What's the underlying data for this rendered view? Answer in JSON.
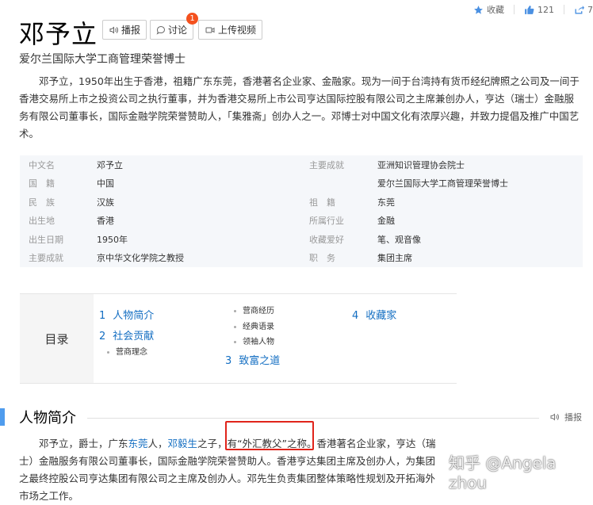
{
  "stats": {
    "collect": "收藏",
    "likes": "121",
    "shares": "7"
  },
  "title": "邓予立",
  "buttons": {
    "broadcast": "播报",
    "discuss": "讨论",
    "discuss_badge": "1",
    "upload": "上传视频"
  },
  "subtitle": "爱尔兰国际大学工商管理荣誉博士",
  "intro": {
    "p1": "邓予立，1950年出生于香港，祖籍广东东莞，香港著名企业家、金融家。现为一间于台湾持有货币经纪牌照之公司及一间于香港交易所上市之投资公司之执行董事，并为香港交易所上市公司亨达国际控股有限公司之主席兼创办人，亨达（瑞士）金融服务有限公司董事长，国际金融学院荣誉赞助人，「集雅斋」创办人之一。邓博士对中国文化有浓厚兴趣，并致力提倡及推广中国艺术。"
  },
  "info": [
    {
      "k": "中文名",
      "v": "邓予立",
      "k2": "主要成就",
      "v2": "亚洲知识管理协会院士"
    },
    {
      "k": "国　籍",
      "v": "中国",
      "k2": "",
      "v2": "爱尔兰国际大学工商管理荣誉博士"
    },
    {
      "k": "民　族",
      "v": "汉族",
      "k2": "祖　籍",
      "v2": "东莞"
    },
    {
      "k": "出生地",
      "v": "香港",
      "k2": "所属行业",
      "v2": "金融"
    },
    {
      "k": "出生日期",
      "v": "1950年",
      "k2": "收藏爱好",
      "v2": "笔、观音像"
    },
    {
      "k": "主要成就",
      "v": "京中华文化学院之教授",
      "k2": "职　务",
      "v2": "集团主席"
    }
  ],
  "catalog": {
    "label": "目录",
    "items": [
      {
        "num": "1",
        "label": "人物简介"
      },
      {
        "num": "2",
        "label": "社会贡献"
      },
      {
        "num": "3",
        "label": "致富之道"
      },
      {
        "num": "4",
        "label": "收藏家"
      }
    ],
    "subitems": [
      "营商理念",
      "营商经历",
      "经典语录",
      "领袖人物"
    ]
  },
  "section": {
    "title": "人物简介",
    "play": "播报"
  },
  "body": {
    "t1": "邓予立，爵士，广东",
    "l1": "东莞",
    "t2": "人，",
    "l2": "邓毅生",
    "t3": "之子，有“外汇教父”之称。香港著名企业家，亨达（瑞士）金融服务有限公司董事长，国际金融学院荣誉赞助人。香港亨达集团主席及创办人，为集团之最终控股公司亨达集团有限公司之主席及创办人。邓先生负责集团整体策略性规划及开拓海外市场之工作。"
  },
  "watermark": "知乎 @Angela zhou",
  "colors": {
    "link": "#136ec2",
    "accent": "#4f9cee",
    "badge": "#f4511e",
    "highlight": "#e0241b"
  }
}
